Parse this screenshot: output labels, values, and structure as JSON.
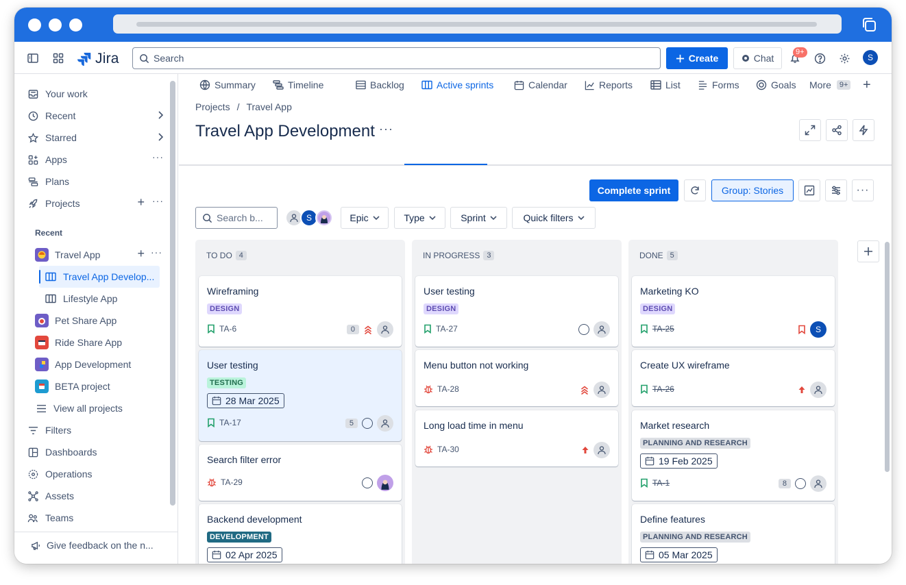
{
  "topnav": {
    "app_name": "Jira",
    "search_placeholder": "Search",
    "create_label": "Create",
    "chat_label": "Chat",
    "notifications_badge": "9+",
    "user_initial": "S"
  },
  "sidebar": {
    "your_work": "Your work",
    "recent": "Recent",
    "starred": "Starred",
    "apps": "Apps",
    "plans": "Plans",
    "projects": "Projects",
    "recent_section": "Recent",
    "projects_list": [
      {
        "label": "Travel App"
      },
      {
        "label": "Travel App Develop..."
      },
      {
        "label": "Lifestyle App"
      },
      {
        "label": "Pet Share App"
      },
      {
        "label": "Ride Share App"
      },
      {
        "label": "App Development"
      },
      {
        "label": "BETA project"
      },
      {
        "label": "View all projects"
      }
    ],
    "filters": "Filters",
    "dashboards": "Dashboards",
    "operations": "Operations",
    "assets": "Assets",
    "teams": "Teams",
    "feedback": "Give feedback on the n..."
  },
  "header": {
    "breadcrumb_projects": "Projects",
    "breadcrumb_sep": "/",
    "breadcrumb_project": "Travel App",
    "title": "Travel App Development",
    "more": "···"
  },
  "tabs": [
    {
      "label": "Summary"
    },
    {
      "label": "Timeline"
    },
    {
      "label": "Backlog"
    },
    {
      "label": "Active sprints"
    },
    {
      "label": "Calendar"
    },
    {
      "label": "Reports"
    },
    {
      "label": "List"
    },
    {
      "label": "Forms"
    },
    {
      "label": "Goals"
    },
    {
      "label": "More",
      "badge": "9+"
    }
  ],
  "toolbar": {
    "complete_sprint": "Complete sprint",
    "group_by": "Group: Stories",
    "search_placeholder": "Search b...",
    "avatar_initial": "S",
    "filters": [
      "Epic",
      "Type",
      "Sprint",
      "Quick filters"
    ]
  },
  "columns": [
    {
      "title": "TO DO",
      "count": "4",
      "cards": [
        {
          "title": "Wireframing",
          "label": "DESIGN",
          "key": "TA-6",
          "estimate": "0"
        },
        {
          "title": "User testing",
          "label": "TESTING",
          "due": "28 Mar 2025",
          "key": "TA-17",
          "estimate": "5"
        },
        {
          "title": "Search filter error",
          "key": "TA-29"
        },
        {
          "title": "Backend development",
          "label": "DEVELOPMENT",
          "due": "02 Apr 2025"
        }
      ]
    },
    {
      "title": "IN PROGRESS",
      "count": "3",
      "cards": [
        {
          "title": "User testing",
          "label": "DESIGN",
          "key": "TA-27"
        },
        {
          "title": "Menu button not working",
          "key": "TA-28"
        },
        {
          "title": "Long load time in menu",
          "key": "TA-30"
        }
      ]
    },
    {
      "title": "DONE",
      "count": "5",
      "cards": [
        {
          "title": "Marketing KO",
          "label": "DESIGN",
          "key": "TA-25",
          "assignee": "S"
        },
        {
          "title": "Create UX wireframe",
          "key": "TA-26"
        },
        {
          "title": "Market research",
          "label": "PLANNING AND RESEARCH",
          "due": "19 Feb 2025",
          "key": "TA-1",
          "estimate": "8"
        },
        {
          "title": "Define features",
          "label": "PLANNING AND RESEARCH",
          "due": "05 Mar 2025"
        }
      ]
    }
  ],
  "colors": {
    "brand": "#0c66e4",
    "titlebar": "#1f6fe0",
    "priority_high": "#e2483d",
    "story_icon": "#22a06b"
  }
}
